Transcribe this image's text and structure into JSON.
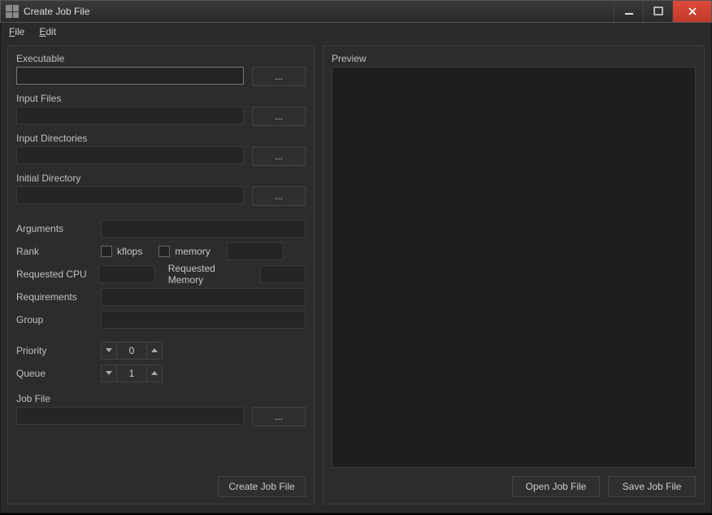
{
  "window": {
    "title": "Create Job File"
  },
  "menu": {
    "file": "File",
    "edit": "Edit"
  },
  "labels": {
    "executable": "Executable",
    "input_files": "Input Files",
    "input_dirs": "Input Directories",
    "initial_dir": "Initial Directory",
    "arguments": "Arguments",
    "rank": "Rank",
    "kflops": "kflops",
    "memory": "memory",
    "req_cpu": "Requested CPU",
    "req_mem": "Requested Memory",
    "requirements": "Requirements",
    "group": "Group",
    "priority": "Priority",
    "queue": "Queue",
    "job_file": "Job File",
    "preview": "Preview"
  },
  "values": {
    "executable": "",
    "input_files": "",
    "input_dirs": "",
    "initial_dir": "",
    "arguments": "",
    "rank_extra": "",
    "req_cpu": "",
    "req_mem": "",
    "requirements": "",
    "group": "",
    "priority": "0",
    "queue": "1",
    "job_file": "",
    "preview": ""
  },
  "buttons": {
    "browse": "...",
    "create": "Create Job File",
    "open": "Open Job File",
    "save": "Save Job File"
  }
}
